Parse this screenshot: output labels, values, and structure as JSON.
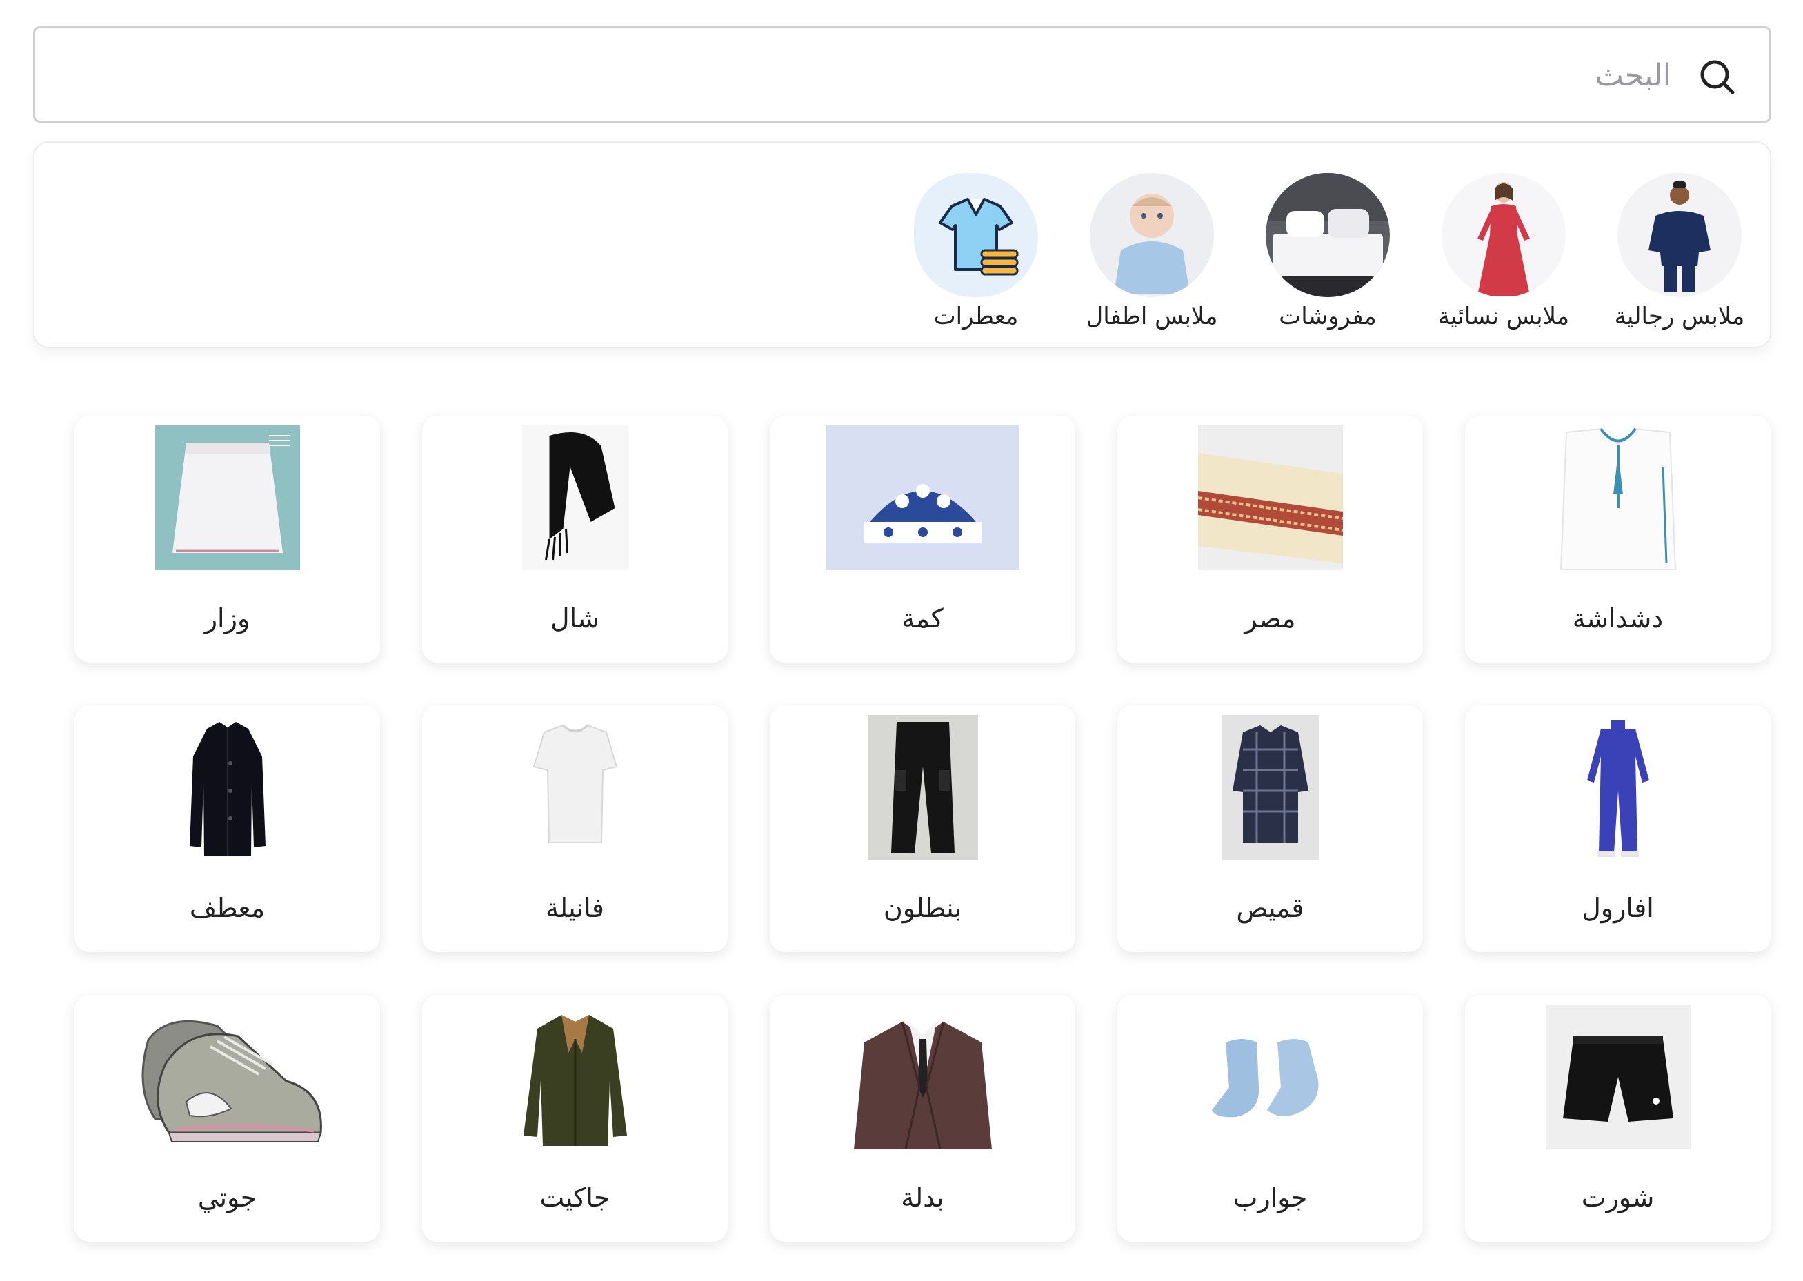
{
  "search": {
    "placeholder": "البحث",
    "value": ""
  },
  "categories": [
    {
      "label": "ملابس رجالية",
      "icon": "men-clothing-photo"
    },
    {
      "label": "ملابس نسائية",
      "icon": "women-clothing-photo"
    },
    {
      "label": "مفروشات",
      "icon": "bedding-photo"
    },
    {
      "label": "ملابس اطفال",
      "icon": "kids-clothing-photo"
    },
    {
      "label": "معطرات",
      "icon": "shirt-laundry-icon"
    }
  ],
  "products": [
    {
      "label": "دشداشة",
      "icon": "dishdasha-image"
    },
    {
      "label": "مصر",
      "icon": "massar-image"
    },
    {
      "label": "كمة",
      "icon": "kumma-cap-image"
    },
    {
      "label": "شال",
      "icon": "shawl-image"
    },
    {
      "label": "وزار",
      "icon": "wizar-image"
    },
    {
      "label": "افارول",
      "icon": "overall-image"
    },
    {
      "label": "قميص",
      "icon": "shirt-image"
    },
    {
      "label": "بنطلون",
      "icon": "trousers-image"
    },
    {
      "label": "فانيلة",
      "icon": "undershirt-image"
    },
    {
      "label": "معطف",
      "icon": "coat-image"
    },
    {
      "label": "شورت",
      "icon": "shorts-image"
    },
    {
      "label": "جوارب",
      "icon": "socks-image"
    },
    {
      "label": "بدلة",
      "icon": "suit-image"
    },
    {
      "label": "جاكيت",
      "icon": "jacket-image"
    },
    {
      "label": "جوتي",
      "icon": "shoes-image"
    }
  ]
}
